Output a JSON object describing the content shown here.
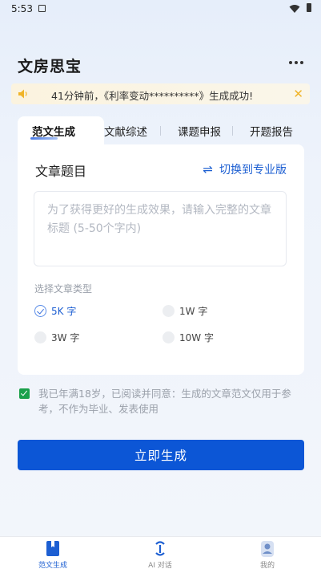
{
  "status": {
    "time": "5:53"
  },
  "header": {
    "title": "文房思宝"
  },
  "notice": {
    "text": "41分钟前，《利率变动**********》生成成功!",
    "close": "✕"
  },
  "tabs": [
    {
      "label": "范文生成"
    },
    {
      "label": "文献综述"
    },
    {
      "label": "课题申报"
    },
    {
      "label": "开题报告"
    }
  ],
  "form": {
    "title_label": "文章题目",
    "switch_label": "切换到专业版",
    "switch_icon": "⇌",
    "input_placeholder": "为了获得更好的生成效果，请输入完整的文章标题 (5-50个字内)",
    "type_label": "选择文章类型",
    "options": [
      {
        "label": "5K 字",
        "selected": true
      },
      {
        "label": "1W 字",
        "selected": false
      },
      {
        "label": "3W 字",
        "selected": false
      },
      {
        "label": "10W 字",
        "selected": false
      }
    ]
  },
  "agreement": {
    "text": "我已年满18岁，已阅读并同意：生成的文章范文仅用于参考，不作为毕业、发表使用",
    "checked": true
  },
  "generate_button": "立即生成",
  "nav": [
    {
      "label": "范文生成",
      "active": true
    },
    {
      "label": "AI 对话",
      "active": false
    },
    {
      "label": "我的",
      "active": false
    }
  ],
  "colors": {
    "primary": "#0c56d6",
    "link": "#1d5fd2",
    "check": "#1aa04a",
    "notice_bg": "#fbf3df",
    "notice_icon": "#f0b429"
  }
}
